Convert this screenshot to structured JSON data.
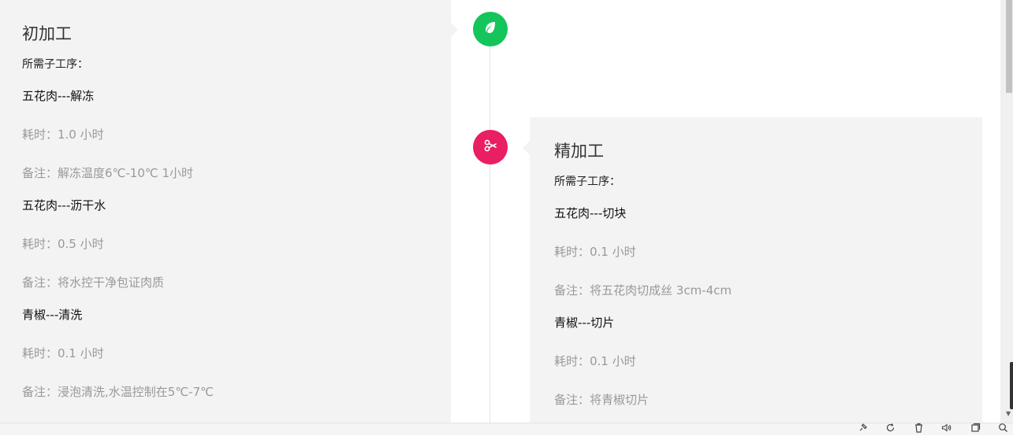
{
  "stages": [
    {
      "title": "初加工",
      "sub_label": "所需子工序：",
      "icon": "leaf-icon",
      "color": "#13c55a",
      "steps": [
        {
          "name": "五花肉---解冻",
          "time": "耗时：1.0  小时",
          "note": "备注：解冻温度6℃-10℃ 1小时"
        },
        {
          "name": "五花肉---沥干水",
          "time": "耗时：0.5  小时",
          "note": "备注：将水控干净包证肉质"
        },
        {
          "name": "青椒---清洗",
          "time": "耗时：0.1  小时",
          "note": "备注：浸泡清洗,水温控制在5℃-7℃"
        }
      ]
    },
    {
      "title": "精加工",
      "sub_label": "所需子工序：",
      "icon": "scissors-icon",
      "color": "#e91e63",
      "steps": [
        {
          "name": "五花肉---切块",
          "time": "耗时：0.1  小时",
          "note": "备注：将五花肉切成丝 3cm-4cm"
        },
        {
          "name": "青椒---切片",
          "time": "耗时：0.1  小时",
          "note": "备注：将青椒切片"
        }
      ]
    }
  ],
  "statusbar": {
    "icons": [
      "pin-icon",
      "refresh-icon",
      "trash-icon",
      "volume-icon",
      "window-icon",
      "search-icon"
    ]
  }
}
